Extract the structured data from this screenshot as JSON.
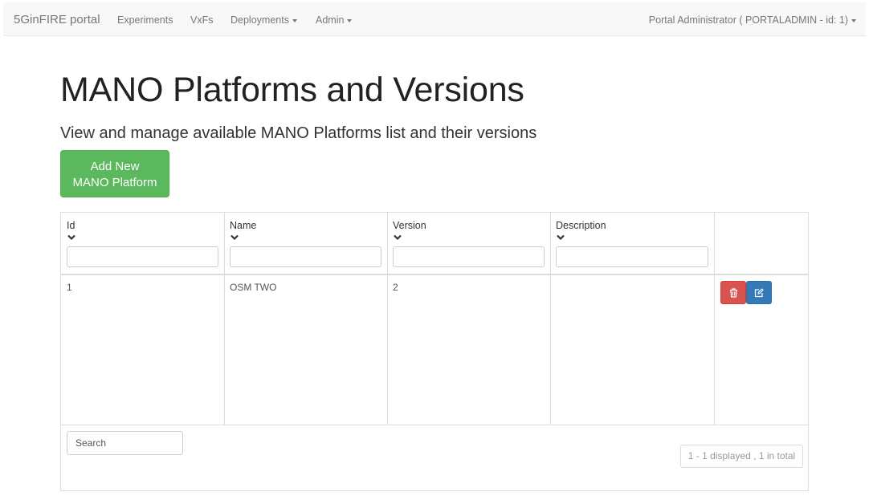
{
  "navbar": {
    "brand": "5GinFIRE portal",
    "items": [
      {
        "label": "Experiments",
        "dropdown": false
      },
      {
        "label": "VxFs",
        "dropdown": false
      },
      {
        "label": "Deployments",
        "dropdown": true
      },
      {
        "label": "Admin",
        "dropdown": true
      }
    ],
    "user": "Portal Administrator ( PORTALADMIN - id: 1)"
  },
  "page": {
    "title": "MANO Platforms and Versions",
    "subtitle": "View and manage available MANO Platforms list and their versions",
    "add_button_line1": "Add New",
    "add_button_line2": "MANO Platform"
  },
  "table": {
    "columns": [
      "Id",
      "Name",
      "Version",
      "Description"
    ],
    "rows": [
      {
        "id": "1",
        "name": "OSM TWO",
        "version": "2",
        "description": ""
      }
    ],
    "search_placeholder": "Search",
    "count_text": "1 - 1 displayed , 1 in total"
  },
  "colors": {
    "success": "#5cb85c",
    "danger": "#d9534f",
    "primary": "#337ab7"
  },
  "icons": {
    "delete": "trash-icon",
    "edit": "edit-icon",
    "sort": "chevron-down-icon"
  }
}
